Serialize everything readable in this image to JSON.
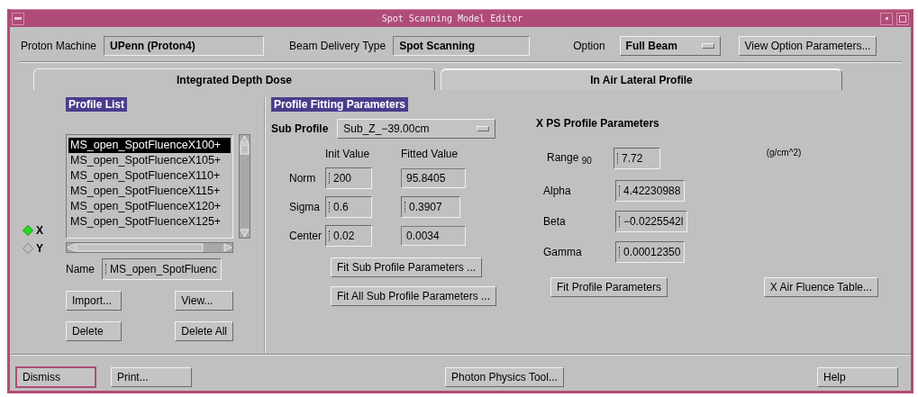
{
  "window": {
    "title": "Spot Scanning Model Editor"
  },
  "header": {
    "proton_machine": {
      "label": "Proton Machine",
      "value": "UPenn (Proton4)"
    },
    "beam_delivery": {
      "label": "Beam Delivery Type",
      "value": "Spot Scanning"
    },
    "option": {
      "label": "Option",
      "value": "Full Beam"
    },
    "view_option_button": "View Option Parameters..."
  },
  "tabs": [
    {
      "label": "Integrated Depth Dose",
      "selected": false
    },
    {
      "label": "In Air Lateral Profile",
      "selected": true
    }
  ],
  "profile_list": {
    "title": "Profile List",
    "axes": [
      {
        "label": "X",
        "selected": true
      },
      {
        "label": "Y",
        "selected": false
      }
    ],
    "items": [
      {
        "label": "MS_open_SpotFluenceX100+",
        "selected": true
      },
      {
        "label": "MS_open_SpotFluenceX105+",
        "selected": false
      },
      {
        "label": "MS_open_SpotFluenceX110+",
        "selected": false
      },
      {
        "label": "MS_open_SpotFluenceX115+",
        "selected": false
      },
      {
        "label": "MS_open_SpotFluenceX120+",
        "selected": false
      },
      {
        "label": "MS_open_SpotFluenceX125+",
        "selected": false
      }
    ],
    "name": {
      "label": "Name",
      "value": "MS_open_SpotFluenc"
    },
    "buttons": [
      "Import...",
      "View...",
      "Delete",
      "Delete All"
    ]
  },
  "fitting": {
    "title": "Profile Fitting Parameters",
    "sub_profile": {
      "label": "Sub Profile",
      "value": "Sub_Z_−39.00cm"
    },
    "columns": [
      "Init Value",
      "Fitted Value"
    ],
    "rows": [
      {
        "label": "Norm",
        "init": "200",
        "fitted": "95.8405",
        "fitted_editable": false
      },
      {
        "label": "Sigma",
        "init": "0.6",
        "fitted": "0.3907",
        "fitted_editable": true
      },
      {
        "label": "Center",
        "init": "0.02",
        "fitted": "0.0034",
        "fitted_editable": false
      }
    ],
    "buttons": [
      "Fit Sub Profile Parameters ...",
      "Fit All Sub Profile Parameters ..."
    ]
  },
  "xps": {
    "title": "X PS Profile Parameters",
    "range": {
      "label": "Range $_{90}$",
      "value": "7.72",
      "unit": "(g/cm^2)"
    },
    "params": [
      {
        "label": "Alpha",
        "value": "4.42230988"
      },
      {
        "label": "Beta",
        "value": "−0.0225542l"
      },
      {
        "label": "Gamma",
        "value": "0.00012350"
      }
    ],
    "buttons": [
      "Fit Profile Parameters",
      "X Air Fluence Table..."
    ]
  },
  "footer": [
    {
      "label": "Dismiss",
      "default": true
    },
    {
      "label": "Print...",
      "default": false
    },
    {
      "label": "Photon Physics Tool...",
      "default": false
    },
    {
      "label": "Help",
      "default": false
    }
  ]
}
